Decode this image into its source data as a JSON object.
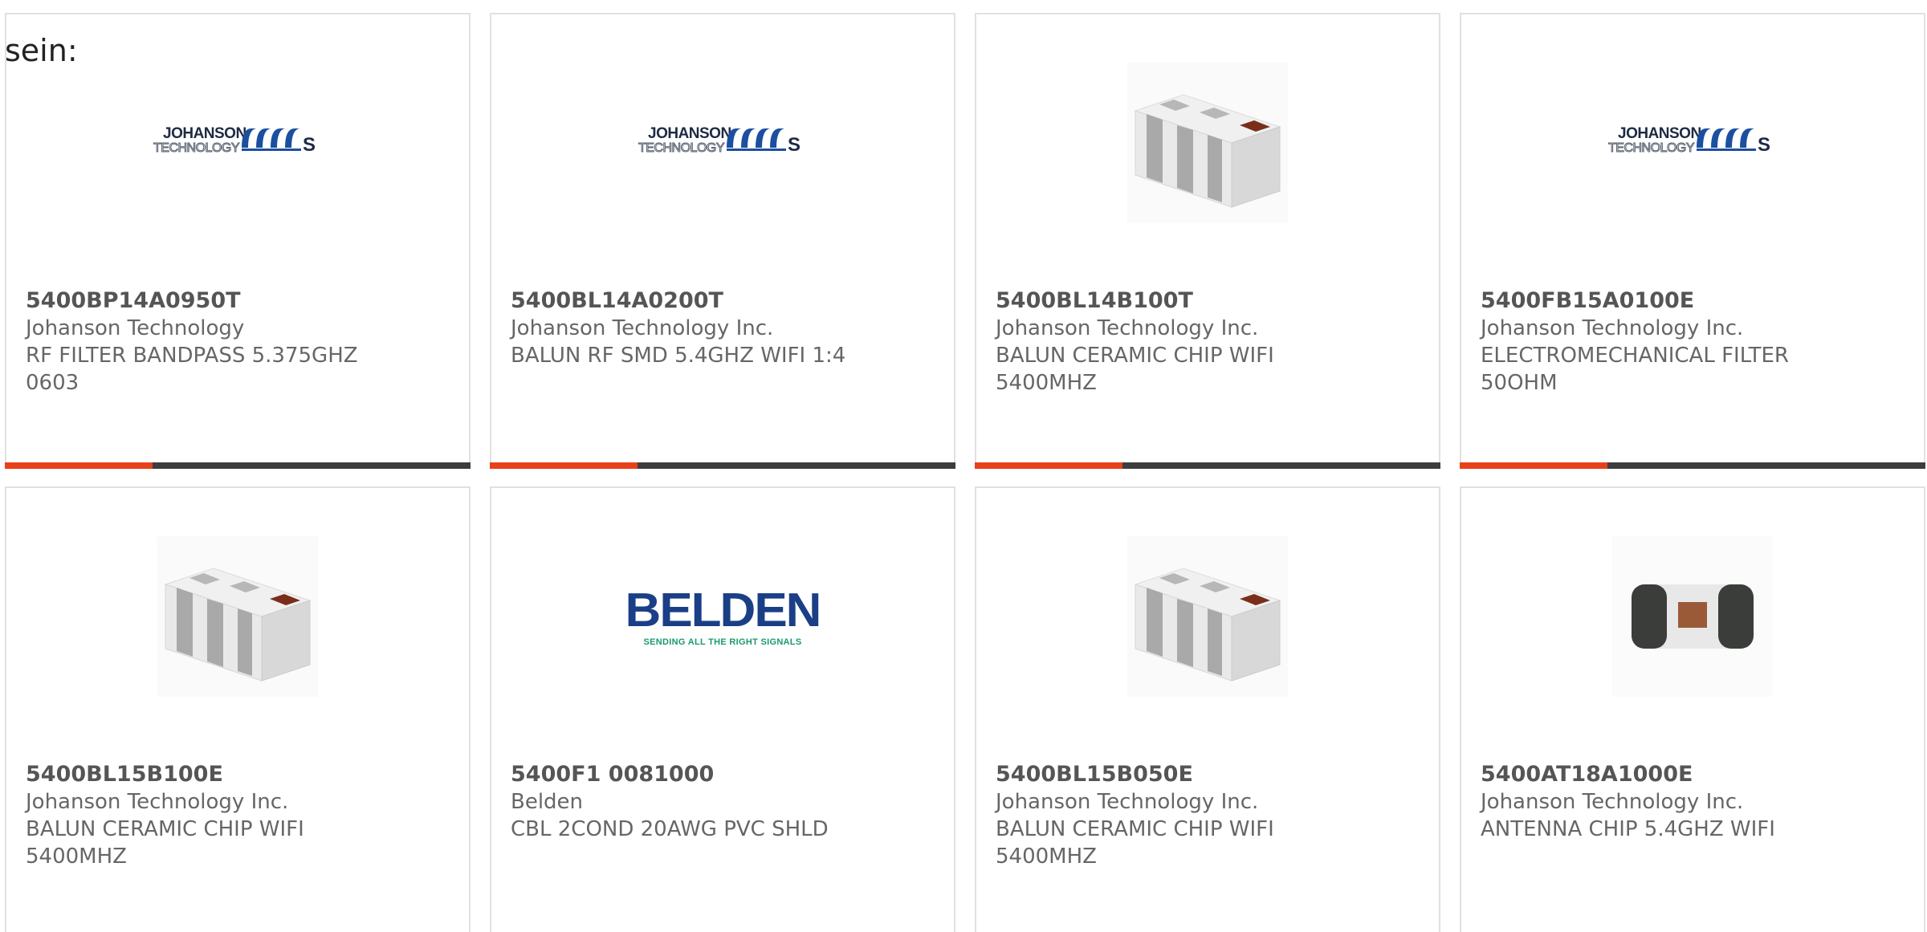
{
  "intro_text": "sein:",
  "colors": {
    "accent": "#e8411a",
    "bar_dark": "#3d3d3d",
    "card_border": "#e1e1e1",
    "text": "#666666"
  },
  "products": [
    {
      "part_number": "5400BP14A0950T",
      "manufacturer": "Johanson Technology",
      "description": "RF FILTER BANDPASS 5.375GHZ 0603",
      "image": "johanson-logo",
      "logo_text_top": "JOHANSON",
      "logo_text_bottom": "TECHNOLOGY"
    },
    {
      "part_number": "5400BL14A0200T",
      "manufacturer": "Johanson Technology Inc.",
      "description": "BALUN RF SMD 5.4GHZ WIFI 1:4",
      "image": "johanson-logo",
      "logo_text_top": "JOHANSON",
      "logo_text_bottom": "TECHNOLOGY"
    },
    {
      "part_number": "5400BL14B100T",
      "manufacturer": "Johanson Technology Inc.",
      "description": "BALUN CERAMIC CHIP WIFI 5400MHZ",
      "image": "balun-chip-photo"
    },
    {
      "part_number": "5400FB15A0100E",
      "manufacturer": "Johanson Technology Inc.",
      "description": "ELECTROMECHANICAL FILTER 50OHM",
      "image": "johanson-logo",
      "logo_text_top": "JOHANSON",
      "logo_text_bottom": "TECHNOLOGY"
    },
    {
      "part_number": "5400BL15B100E",
      "manufacturer": "Johanson Technology Inc.",
      "description": "BALUN CERAMIC CHIP WIFI 5400MHZ",
      "image": "balun-chip-photo"
    },
    {
      "part_number": "5400F1 0081000",
      "manufacturer": "Belden",
      "description": "CBL 2COND 20AWG PVC SHLD",
      "image": "belden-logo",
      "logo_text_top": "BELDEN",
      "logo_text_bottom": "SENDING ALL THE RIGHT SIGNALS"
    },
    {
      "part_number": "5400BL15B050E",
      "manufacturer": "Johanson Technology Inc.",
      "description": "BALUN CERAMIC CHIP WIFI 5400MHZ",
      "image": "balun-chip-photo"
    },
    {
      "part_number": "5400AT18A1000E",
      "manufacturer": "Johanson Technology Inc.",
      "description": "ANTENNA CHIP 5.4GHZ WIFI",
      "image": "antenna-chip-photo"
    }
  ]
}
